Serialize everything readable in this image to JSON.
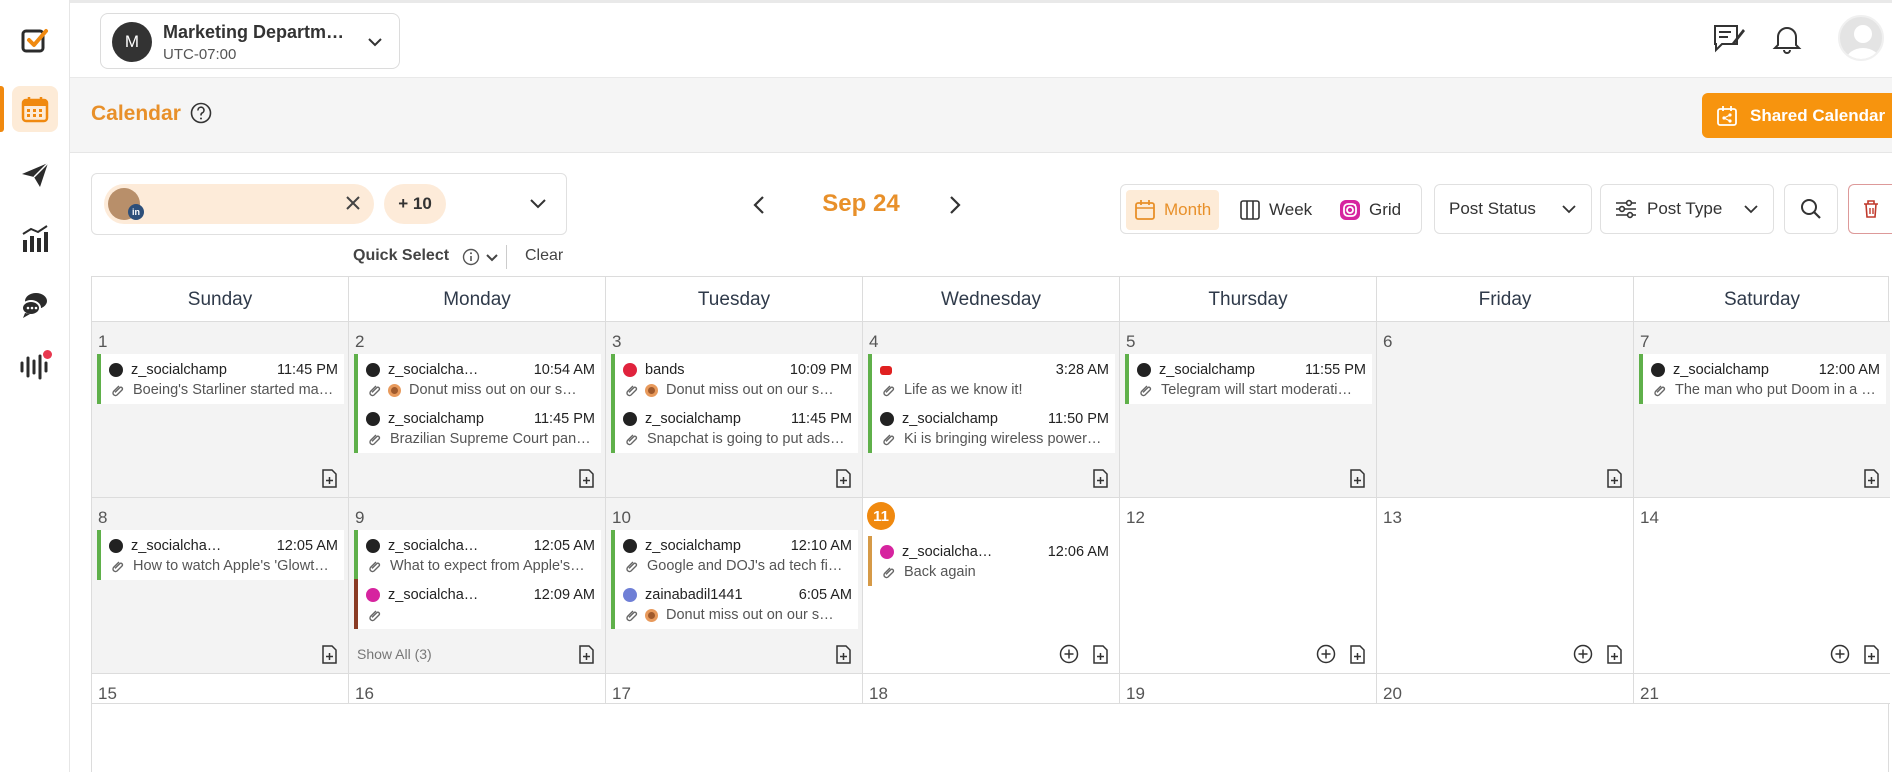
{
  "workspace": {
    "initial": "M",
    "name": "Marketing Departm…",
    "timezone": "UTC-07:00"
  },
  "page": {
    "title": "Calendar",
    "shared_calendar_label": "Shared Calendar"
  },
  "filters": {
    "linkedin_badge": "in",
    "more_accounts": "+ 10",
    "quick_select_label": "Quick Select",
    "clear_label": "Clear",
    "month_label": "Sep 24",
    "views": [
      "Month",
      "Week",
      "Grid"
    ],
    "active_view": "Month",
    "post_status_label": "Post Status",
    "post_type_label": "Post Type"
  },
  "colors": {
    "accent": "#f0890f",
    "brand_orange": "#f7940e",
    "published_bar": "#5fb04a"
  },
  "weekdays": [
    "Sunday",
    "Monday",
    "Tuesday",
    "Wednesday",
    "Thursday",
    "Friday",
    "Saturday"
  ],
  "weeks": [
    [
      {
        "day": "1",
        "posts": [
          {
            "network": "threads",
            "account": "z_socialchamp",
            "time": "11:45 PM",
            "text": "Boeing's Starliner started ma…"
          }
        ]
      },
      {
        "day": "2",
        "posts": [
          {
            "network": "threads",
            "account": "z_socialcha…",
            "time": "10:54 AM",
            "text": "Donut miss out on our s…",
            "donut": true
          },
          {
            "network": "threads",
            "account": "z_socialchamp",
            "time": "11:45 PM",
            "text": "Brazilian Supreme Court pan…"
          }
        ]
      },
      {
        "day": "3",
        "posts": [
          {
            "network": "pin",
            "account": "bands",
            "time": "10:09 PM",
            "text": "Donut miss out on our s…",
            "donut": true
          },
          {
            "network": "threads",
            "account": "z_socialchamp",
            "time": "11:45 PM",
            "text": "Snapchat is going to put ads…"
          }
        ]
      },
      {
        "day": "4",
        "posts": [
          {
            "network": "yt",
            "account": "",
            "time": "3:28 AM",
            "text": "Life as we know it!"
          },
          {
            "network": "threads",
            "account": "z_socialchamp",
            "time": "11:50 PM",
            "text": "Ki is bringing wireless power…"
          }
        ]
      },
      {
        "day": "5",
        "posts": [
          {
            "network": "threads",
            "account": "z_socialchamp",
            "time": "11:55 PM",
            "text": "Telegram will start moderati…"
          }
        ]
      },
      {
        "day": "6",
        "posts": []
      },
      {
        "day": "7",
        "posts": [
          {
            "network": "threads",
            "account": "z_socialchamp",
            "time": "12:00 AM",
            "text": "The man who put Doom in a Le…"
          }
        ]
      }
    ],
    [
      {
        "day": "8",
        "posts": [
          {
            "network": "threads",
            "account": "z_socialcha…",
            "time": "12:05 AM",
            "text": "How to watch Apple's 'Glowt…"
          }
        ]
      },
      {
        "day": "9",
        "posts": [
          {
            "network": "threads",
            "account": "z_socialcha…",
            "time": "12:05 AM",
            "text": "What to expect from Apple's…"
          },
          {
            "network": "ig",
            "account": "z_socialcha…",
            "time": "12:09 AM",
            "text": "",
            "bar": "red"
          }
        ],
        "show_all": "Show All (3)"
      },
      {
        "day": "10",
        "posts": [
          {
            "network": "threads",
            "account": "z_socialchamp",
            "time": "12:10 AM",
            "text": "Google and DOJ's ad tech fi…"
          },
          {
            "network": "msg",
            "account": "zainabadil1441",
            "time": "6:05 AM",
            "text": "Donut miss out on our s…",
            "donut": true
          }
        ]
      },
      {
        "day": "11",
        "today": true,
        "posts": [
          {
            "network": "ig",
            "account": "z_socialcha…",
            "time": "12:06 AM",
            "text": "Back again",
            "bar": "orange"
          }
        ]
      },
      {
        "day": "12",
        "posts": []
      },
      {
        "day": "13",
        "posts": []
      },
      {
        "day": "14",
        "posts": []
      }
    ],
    [
      {
        "day": "15",
        "posts": []
      },
      {
        "day": "16",
        "posts": []
      },
      {
        "day": "17",
        "posts": []
      },
      {
        "day": "18",
        "posts": []
      },
      {
        "day": "19",
        "posts": []
      },
      {
        "day": "20",
        "posts": []
      },
      {
        "day": "21",
        "posts": []
      }
    ]
  ]
}
